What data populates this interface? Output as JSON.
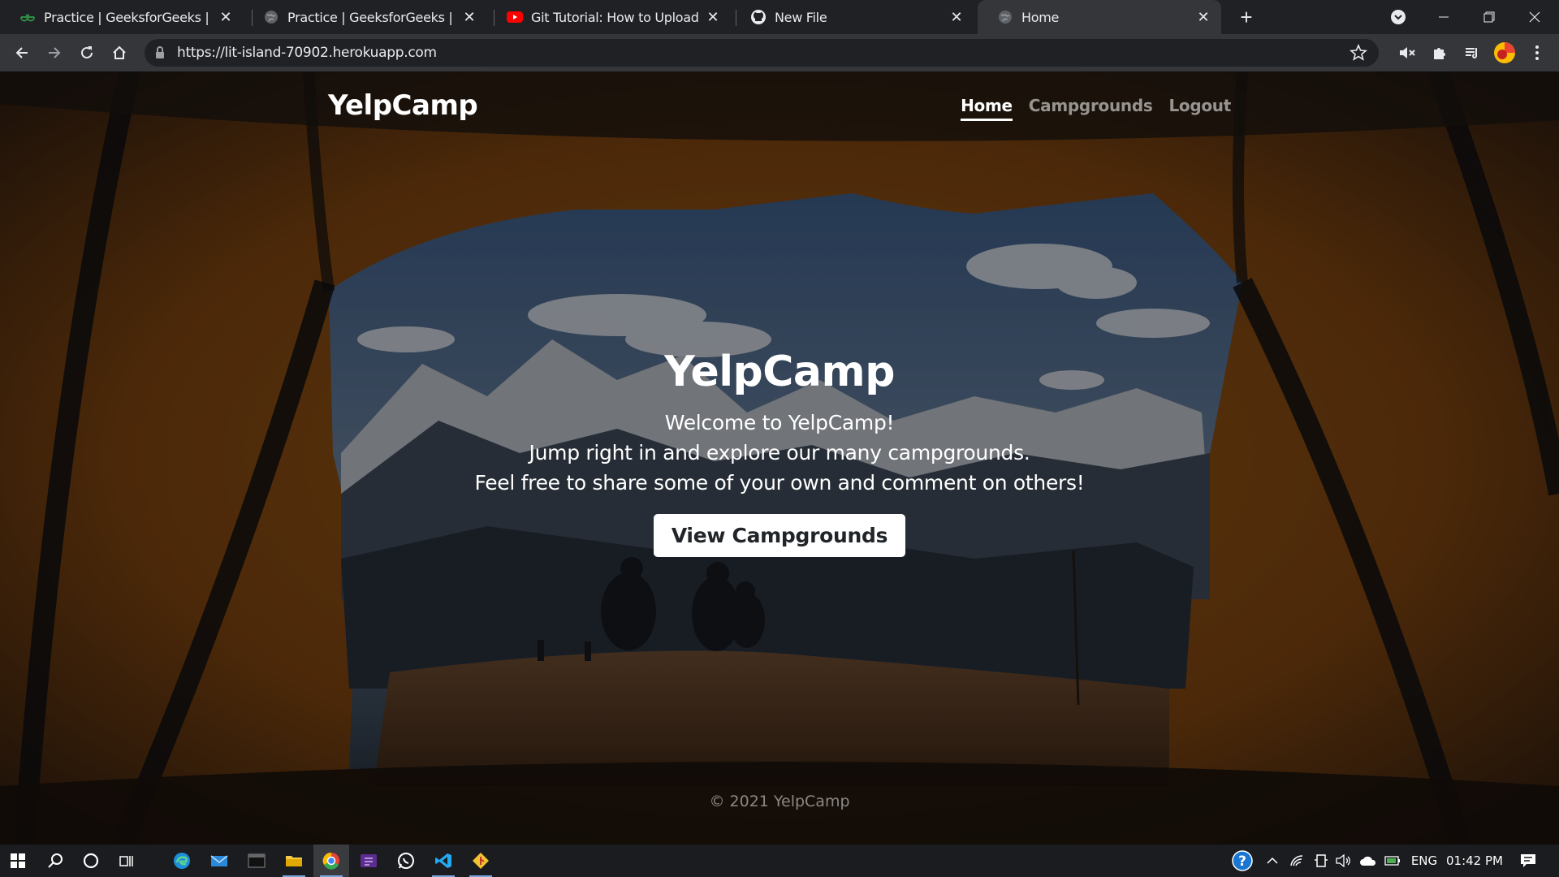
{
  "browser": {
    "tabs": [
      {
        "title": "Practice | GeeksforGeeks | A com",
        "icon": "geeksforgeeks-icon"
      },
      {
        "title": "Practice | GeeksforGeeks | A com",
        "icon": "globe-icon"
      },
      {
        "title": "Git Tutorial: How to Upload your",
        "icon": "youtube-icon"
      },
      {
        "title": "New File",
        "icon": "github-icon"
      },
      {
        "title": "Home",
        "icon": "globe-icon",
        "active": true
      }
    ],
    "url_host": "https://lit-island-70902.herokuapp.com",
    "new_tab_label": "+"
  },
  "page": {
    "brand": "YelpCamp",
    "nav": {
      "home": "Home",
      "campgrounds": "Campgrounds",
      "logout": "Logout"
    },
    "hero": {
      "title": "YelpCamp",
      "line1": "Welcome to YelpCamp!",
      "line2": "Jump right in and explore our many campgrounds.",
      "line3": "Feel free to share some of your own and comment on others!",
      "button": "View Campgrounds"
    },
    "footer": "© 2021 YelpCamp"
  },
  "taskbar": {
    "language": "ENG",
    "time": "01:42 PM"
  },
  "colors": {
    "chrome_dark": "#202124",
    "chrome_toolbar": "#35363a",
    "tent_orange": "#c47a1e",
    "button_bg": "#ffffff"
  }
}
